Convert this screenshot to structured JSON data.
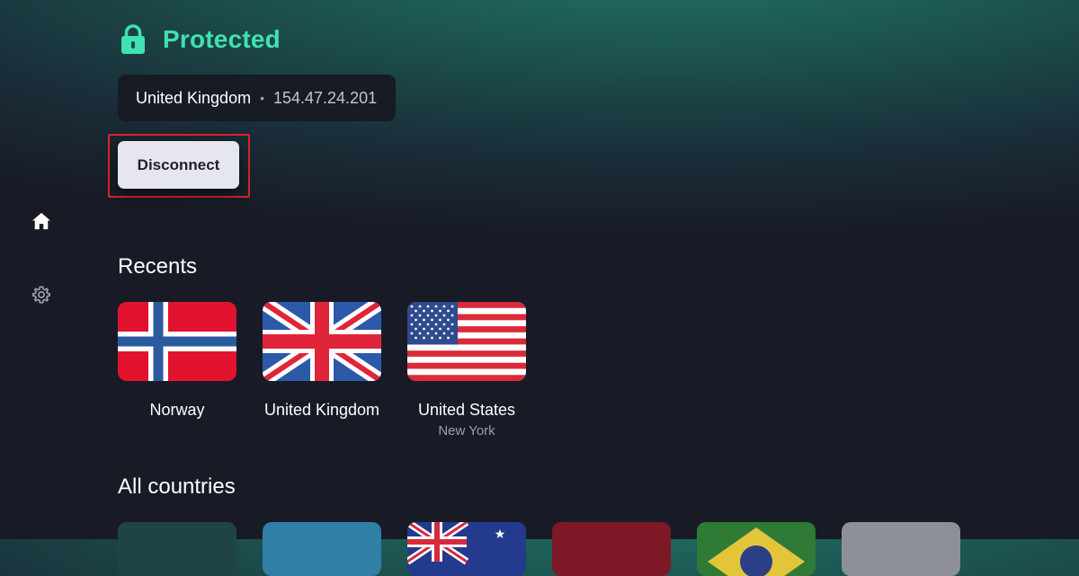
{
  "sidebar": {
    "items": [
      {
        "name": "home",
        "icon": "home-icon"
      },
      {
        "name": "settings",
        "icon": "gear-icon"
      }
    ]
  },
  "status": {
    "text": "Protected",
    "icon": "lock-icon",
    "color": "#3fe2b0"
  },
  "connection": {
    "country": "United Kingdom",
    "separator": "•",
    "ip": "154.47.24.201"
  },
  "disconnect_label": "Disconnect",
  "recents": {
    "title": "Recents",
    "items": [
      {
        "name": "Norway",
        "subtitle": "",
        "flag": "norway-flag"
      },
      {
        "name": "United Kingdom",
        "subtitle": "",
        "flag": "uk-flag"
      },
      {
        "name": "United States",
        "subtitle": "New York",
        "flag": "us-flag"
      }
    ]
  },
  "all_countries": {
    "title": "All countries",
    "tiles": [
      "dark-teal-flag",
      "light-blue-flag",
      "australia-flag",
      "maroon-flag",
      "brazil-flag",
      "grey-flag"
    ]
  },
  "colors": {
    "accent": "#3fe2b0",
    "focus_ring": "#e0242b",
    "background": "#181b26"
  }
}
